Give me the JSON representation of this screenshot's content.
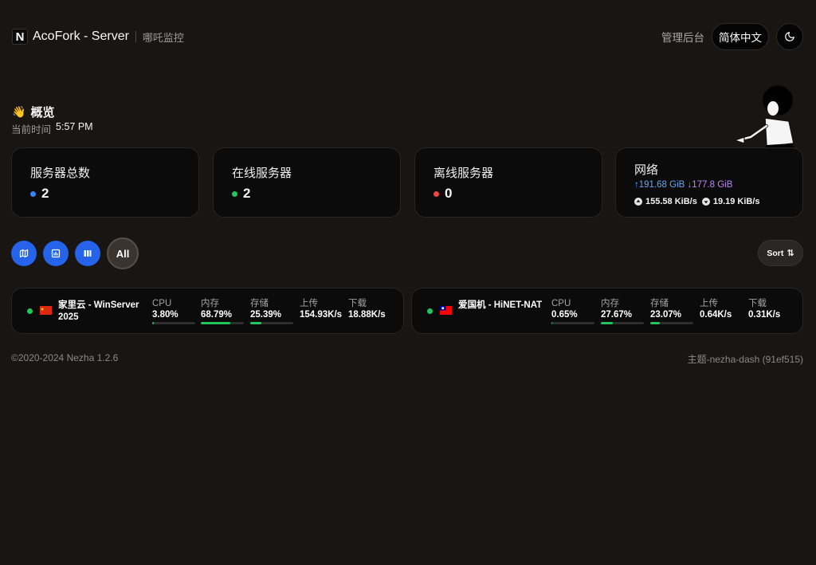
{
  "header": {
    "logo_letter": "N",
    "site_title": "AcoFork - Server",
    "subtitle": "哪吒监控",
    "admin_link": "管理后台",
    "language": "简体中文",
    "theme_icon": "moon-icon"
  },
  "overview": {
    "title": "概览",
    "wave_emoji": "👋",
    "time_label": "当前时间",
    "time_value": "5:57 PM"
  },
  "stats": {
    "total": {
      "title": "服务器总数",
      "value": "2",
      "dot_color": "#3b82f6"
    },
    "online": {
      "title": "在线服务器",
      "value": "2",
      "dot_color": "#22c55e"
    },
    "offline": {
      "title": "离线服务器",
      "value": "0",
      "dot_color": "#ef4444"
    },
    "network": {
      "title": "网络",
      "upload_total": "↑191.68 GiB",
      "download_total": "↓177.8 GiB",
      "upload_speed": "155.58 KiB/s",
      "download_speed": "19.19 KiB/s"
    }
  },
  "filters": {
    "buttons": [
      {
        "icon": "map-icon"
      },
      {
        "icon": "chart-icon"
      },
      {
        "icon": "columns-icon"
      }
    ],
    "all_label": "All",
    "sort_label": "Sort",
    "sort_icon": "⇅"
  },
  "metric_labels": {
    "cpu": "CPU",
    "mem": "内存",
    "disk": "存储",
    "up": "上传",
    "down": "下载"
  },
  "servers": [
    {
      "name": "家里云 - WinServer 2025",
      "flag": "cn-flag-icon",
      "cpu": "3.80%",
      "cpu_pct": 3.8,
      "mem": "68.79%",
      "mem_pct": 68.79,
      "disk": "25.39%",
      "disk_pct": 25.39,
      "up": "154.93K/s",
      "down": "18.88K/s"
    },
    {
      "name": "爱国机 - HiNET-NAT",
      "flag": "tw-flag-icon",
      "cpu": "0.65%",
      "cpu_pct": 0.65,
      "mem": "27.67%",
      "mem_pct": 27.67,
      "disk": "23.07%",
      "disk_pct": 23.07,
      "up": "0.64K/s",
      "down": "0.31K/s"
    }
  ],
  "footer": {
    "copyright": "©2020-2024 Nezha 1.2.6",
    "theme": "主题-nezha-dash (91ef515)"
  },
  "colors": {
    "accent": "#2563eb",
    "online": "#22c55e",
    "offline": "#ef4444",
    "upload": "#60a5fa",
    "download": "#c084fc"
  }
}
